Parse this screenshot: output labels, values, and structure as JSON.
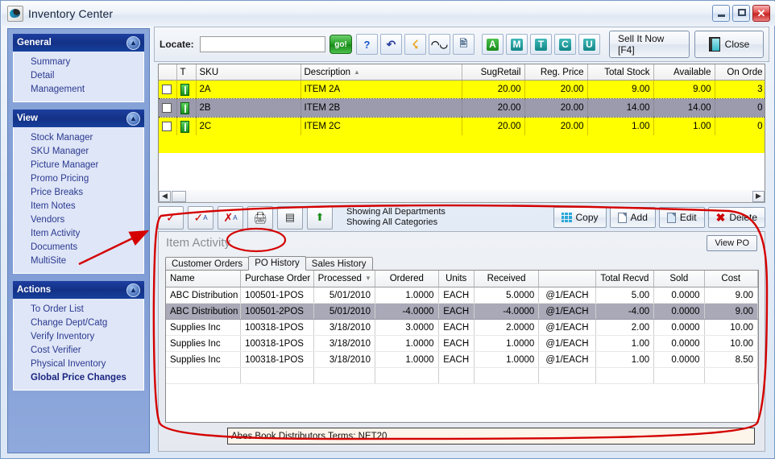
{
  "window": {
    "title": "Inventory Center",
    "icon": "app-logo-icon",
    "minimize_label": "–",
    "maximize_label": "□",
    "close_label": "✕"
  },
  "sidebar": {
    "groups": [
      {
        "title": "General",
        "collapse_icon": "chevron-up-icon",
        "items": [
          {
            "label": "Summary",
            "bold": false
          },
          {
            "label": "Detail",
            "bold": false
          },
          {
            "label": "Management",
            "bold": false
          }
        ]
      },
      {
        "title": "View",
        "collapse_icon": "chevron-up-icon",
        "items": [
          {
            "label": "Stock Manager",
            "bold": false
          },
          {
            "label": "SKU Manager",
            "bold": false
          },
          {
            "label": "Picture Manager",
            "bold": false
          },
          {
            "label": "Promo Pricing",
            "bold": false
          },
          {
            "label": "Price Breaks",
            "bold": false
          },
          {
            "label": "Item Notes",
            "bold": false
          },
          {
            "label": "Vendors",
            "bold": false
          },
          {
            "label": "Item Activity",
            "bold": false
          },
          {
            "label": "Documents",
            "bold": false
          },
          {
            "label": "MultiSite",
            "bold": false
          }
        ]
      },
      {
        "title": "Actions",
        "collapse_icon": "chevron-up-icon",
        "items": [
          {
            "label": "To Order List",
            "bold": false
          },
          {
            "label": "Change Dept/Catg",
            "bold": false
          },
          {
            "label": "Verify Inventory",
            "bold": false
          },
          {
            "label": "Cost Verifier",
            "bold": false
          },
          {
            "label": "Physical Inventory",
            "bold": false
          },
          {
            "label": "Global Price Changes",
            "bold": true
          }
        ]
      }
    ]
  },
  "toolbar": {
    "locate_label": "Locate:",
    "locate_value": "",
    "locate_placeholder": "",
    "go_label": "go!",
    "icon_buttons": [
      {
        "name": "help-icon",
        "glyph": "?"
      },
      {
        "name": "refresh-icon",
        "glyph": "↺"
      },
      {
        "name": "lightning-icon",
        "glyph": "⚡"
      },
      {
        "name": "binoculars-icon",
        "glyph": "୨୨"
      },
      {
        "name": "preview-icon",
        "glyph": "▤"
      }
    ],
    "letter_buttons": [
      {
        "name": "filter-a-button",
        "label": "A",
        "color": "#1a8b1a"
      },
      {
        "name": "filter-m-button",
        "label": "M",
        "color": "#138686"
      },
      {
        "name": "filter-t-button",
        "label": "T",
        "color": "#138686"
      },
      {
        "name": "filter-c-button",
        "label": "C",
        "color": "#138686"
      },
      {
        "name": "filter-u-button",
        "label": "U",
        "color": "#138686"
      }
    ],
    "sell_now_label": "Sell It Now [F4]",
    "close_label": "Close"
  },
  "item_grid": {
    "columns": [
      {
        "key": "check",
        "label": ""
      },
      {
        "key": "t",
        "label": "T"
      },
      {
        "key": "sku",
        "label": "SKU"
      },
      {
        "key": "description",
        "label": "Description",
        "sorted": true
      },
      {
        "key": "sugretail",
        "label": "SugRetail",
        "align": "right"
      },
      {
        "key": "regprice",
        "label": "Reg. Price",
        "align": "right"
      },
      {
        "key": "totalstock",
        "label": "Total Stock",
        "align": "right"
      },
      {
        "key": "available",
        "label": "Available",
        "align": "right"
      },
      {
        "key": "onorder",
        "label": "On Orde",
        "align": "right"
      }
    ],
    "rows": [
      {
        "sku": "2A",
        "description": "ITEM 2A",
        "sugretail": "20.00",
        "regprice": "20.00",
        "totalstock": "9.00",
        "available": "9.00",
        "onorder": "3",
        "selected": false
      },
      {
        "sku": "2B",
        "description": "ITEM 2B",
        "sugretail": "20.00",
        "regprice": "20.00",
        "totalstock": "14.00",
        "available": "14.00",
        "onorder": "0",
        "selected": true
      },
      {
        "sku": "2C",
        "description": "ITEM 2C",
        "sugretail": "20.00",
        "regprice": "20.00",
        "totalstock": "1.00",
        "available": "1.00",
        "onorder": "0",
        "selected": false
      }
    ]
  },
  "action_bar": {
    "tool_icons": [
      {
        "name": "check-mark-button",
        "glyph": "✓"
      },
      {
        "name": "check-all-button",
        "glyph": "✓"
      },
      {
        "name": "uncheck-all-button",
        "glyph": "✗"
      },
      {
        "name": "print-button",
        "glyph": "⎙"
      },
      {
        "name": "list-view-button",
        "glyph": "☰"
      },
      {
        "name": "export-button",
        "glyph": "⇧"
      }
    ],
    "showing_line1": "Showing All Departments",
    "showing_line2": "Showing All Categories",
    "copy_label": "Copy",
    "add_label": "Add",
    "edit_label": "Edit",
    "delete_label": "Delete"
  },
  "activity_panel": {
    "title": "Item Activity",
    "view_po_label": "View PO",
    "tabs": [
      {
        "label": "Customer Orders",
        "active": false
      },
      {
        "label": "PO History",
        "active": true
      },
      {
        "label": "Sales History",
        "active": false
      }
    ],
    "po_table": {
      "columns": [
        {
          "key": "name",
          "label": "Name"
        },
        {
          "key": "purchase_order",
          "label": "Purchase Order"
        },
        {
          "key": "processed",
          "label": "Processed",
          "sorted": true
        },
        {
          "key": "ordered",
          "label": "Ordered",
          "align": "right"
        },
        {
          "key": "units",
          "label": "Units",
          "align": "center"
        },
        {
          "key": "received",
          "label": "Received",
          "align": "right"
        },
        {
          "key": "rate",
          "label": "",
          "align": "center"
        },
        {
          "key": "total_recvd",
          "label": "Total Recvd",
          "align": "right"
        },
        {
          "key": "sold",
          "label": "Sold",
          "align": "right"
        },
        {
          "key": "cost",
          "label": "Cost",
          "align": "right"
        }
      ],
      "rows": [
        {
          "name": "ABC Distribution",
          "purchase_order": "100501-1POS",
          "processed": "5/01/2010",
          "ordered": "1.0000",
          "units": "EACH",
          "received": "5.0000",
          "rate": "@1/EACH",
          "total_recvd": "5.00",
          "sold": "0.0000",
          "cost": "9.00",
          "selected": false
        },
        {
          "name": "ABC Distribution",
          "purchase_order": "100501-2POS",
          "processed": "5/01/2010",
          "ordered": "-4.0000",
          "units": "EACH",
          "received": "-4.0000",
          "rate": "@1/EACH",
          "total_recvd": "-4.00",
          "sold": "0.0000",
          "cost": "9.00",
          "selected": true
        },
        {
          "name": "Supplies Inc",
          "purchase_order": "100318-1POS",
          "processed": "3/18/2010",
          "ordered": "3.0000",
          "units": "EACH",
          "received": "2.0000",
          "rate": "@1/EACH",
          "total_recvd": "2.00",
          "sold": "0.0000",
          "cost": "10.00",
          "selected": false
        },
        {
          "name": "Supplies Inc",
          "purchase_order": "100318-1POS",
          "processed": "3/18/2010",
          "ordered": "1.0000",
          "units": "EACH",
          "received": "1.0000",
          "rate": "@1/EACH",
          "total_recvd": "1.00",
          "sold": "0.0000",
          "cost": "10.00",
          "selected": false
        },
        {
          "name": "Supplies Inc",
          "purchase_order": "100318-1POS",
          "processed": "3/18/2010",
          "ordered": "1.0000",
          "units": "EACH",
          "received": "1.0000",
          "rate": "@1/EACH",
          "total_recvd": "1.00",
          "sold": "0.0000",
          "cost": "8.50",
          "selected": false
        }
      ]
    },
    "status_line": "Abes Book Distributors  Terms: NET20"
  },
  "annotations": {
    "accent_color": "#cc0000",
    "arrow_target": "Item Activity",
    "ellipse_target": "PO History"
  }
}
